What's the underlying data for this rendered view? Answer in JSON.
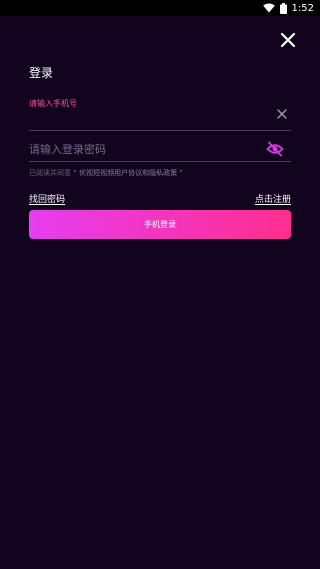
{
  "status_bar": {
    "time": "1:52",
    "wifi_icon": "wifi-icon",
    "battery_icon": "battery-icon"
  },
  "header": {
    "close_icon": "close-icon",
    "title": "登录"
  },
  "form": {
    "phone_label": "请输入手机号",
    "phone_value": "",
    "clear_icon": "clear-icon",
    "password_placeholder": "请输入登录密码",
    "password_value": "",
    "visibility_icon": "eye-off-icon",
    "agreement_prefix": "已阅读并同意",
    "agreement_links": "“ 优视短视频用户协议和隐私政策 ”"
  },
  "links": {
    "forgot_password": "找回密码",
    "register": "点击注册"
  },
  "login_button": {
    "label": "手机登录"
  },
  "colors": {
    "background": "#12031f",
    "accent_pink": "#ff4fa0",
    "button_start": "#e63df0",
    "button_end": "#ff2e8f"
  }
}
